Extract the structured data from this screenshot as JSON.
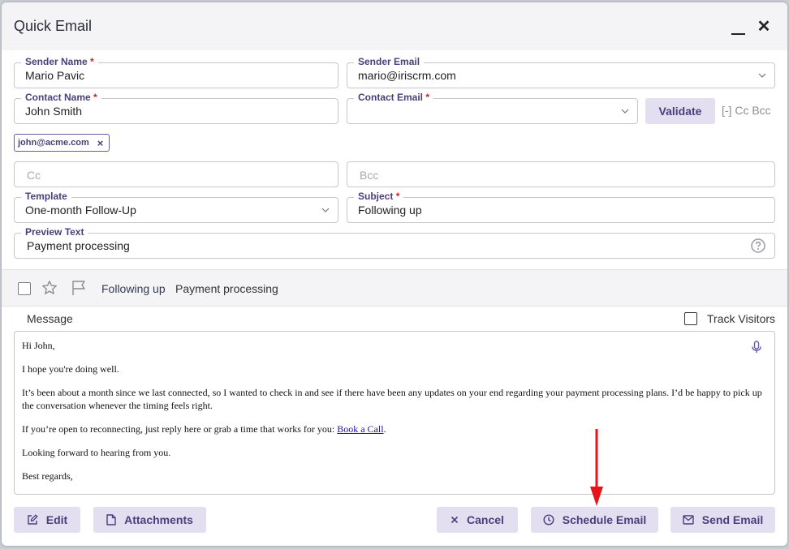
{
  "dialog": {
    "title": "Quick Email"
  },
  "sender_name": {
    "label": "Sender Name",
    "required": "*",
    "value": "Mario Pavic"
  },
  "sender_email": {
    "label": "Sender Email",
    "value": "mario@iriscrm.com"
  },
  "contact_name": {
    "label": "Contact Name",
    "required": "*",
    "value": "John Smith"
  },
  "contact_email": {
    "label": "Contact Email",
    "required": "*",
    "value": ""
  },
  "validate_label": "Validate",
  "cc_bcc_toggle": "[-] Cc Bcc",
  "recipient_chip": {
    "email": "john@acme.com",
    "remove": "×"
  },
  "cc": {
    "placeholder": "Cc"
  },
  "bcc": {
    "placeholder": "Bcc"
  },
  "template": {
    "label": "Template",
    "value": "One-month Follow-Up"
  },
  "subject": {
    "label": "Subject",
    "required": "*",
    "value": "Following up"
  },
  "preview_text": {
    "label": "Preview Text",
    "value": "Payment processing"
  },
  "inbox_preview": {
    "subject": "Following up",
    "text": "Payment processing"
  },
  "message": {
    "label": "Message",
    "track_label": "Track Visitors",
    "greeting": "Hi John,",
    "line1": "I hope you're doing well.",
    "line2": "It’s been about a month since we last connected, so I wanted to check in and see if there have been any updates on your end regarding your payment processing plans. I’d be happy to pick up the conversation whenever the timing feels right.",
    "line3_prefix": "If you’re open to reconnecting, just reply here or grab a time that works for you: ",
    "line3_link": "Book a Call",
    "line3_suffix": ".",
    "line4": "Looking forward to hearing from you.",
    "signoff": "Best regards,"
  },
  "footer": {
    "edit": "Edit",
    "attachments": "Attachments",
    "cancel": "Cancel",
    "schedule": "Schedule Email",
    "send": "Send Email"
  },
  "colors": {
    "accent": "#4a3d7c",
    "button_bg": "#e4dff0",
    "required": "#d11f1f",
    "annotation_arrow": "#e8141b"
  },
  "icons": [
    "minimize-icon",
    "close-icon",
    "chevron-down-icon",
    "remove-icon",
    "help-icon",
    "checkbox-icon",
    "star-icon",
    "flag-icon",
    "microphone-icon",
    "edit-icon",
    "file-icon",
    "x-icon",
    "clock-icon",
    "envelope-icon",
    "red-arrow-annotation"
  ]
}
